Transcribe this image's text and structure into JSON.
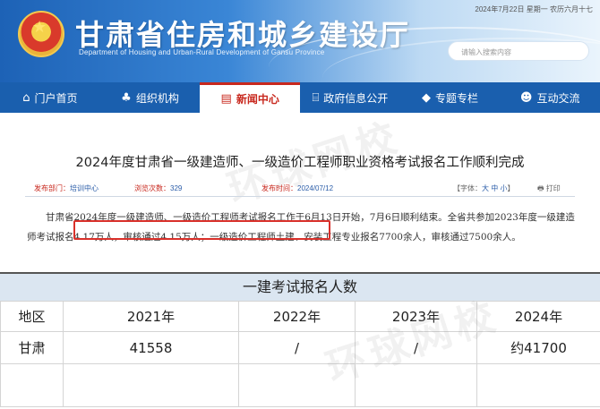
{
  "header": {
    "site_title": "甘肃省住房和城乡建设厅",
    "site_subtitle": "Department of Housing and Urban-Rural Development of Gansu Province",
    "date_line": "2024年7月22日  星期一  农历六月十七",
    "search_placeholder": "请输入搜索内容"
  },
  "nav": {
    "items": [
      {
        "label": "门户首页",
        "icon": "home-icon",
        "glyph": "⌂"
      },
      {
        "label": "组织机构",
        "icon": "org-chart-icon",
        "glyph": "♣"
      },
      {
        "label": "新闻中心",
        "icon": "news-icon",
        "glyph": "▤"
      },
      {
        "label": "政府信息公开",
        "icon": "government-building-icon",
        "glyph": "⌸"
      },
      {
        "label": "专题专栏",
        "icon": "tag-icon",
        "glyph": "◆"
      },
      {
        "label": "互动交流",
        "icon": "user-chat-icon",
        "glyph": "☻"
      }
    ],
    "active_index": 2
  },
  "article": {
    "title": "2024年度甘肃省一级建造师、一级造价工程师职业资格考试报名工作顺利完成",
    "meta": {
      "dept_label": "发布部门：",
      "dept_value": "培训中心",
      "views_label": "浏览次数：",
      "views_value": "329",
      "time_label": "发布时间：",
      "time_value": "2024/07/12",
      "font_label": "【字体：",
      "font_large": "大",
      "font_medium": "中",
      "font_small": "小",
      "font_close": "】",
      "print_label": "打印"
    },
    "body_part1": "甘肃省2024年度一级建造师、一级造价工程师考试报名工作于6月13日开始，7月6日顺利结束。全省共参加2023年度",
    "body_highlight": "一级建造师考试报名4.17万人，审核通过4.15万人；",
    "body_part2": "一级造价工程师土建、安装工程专业报名7700余人，审核通过7500余人。"
  },
  "watermark": "环球网校",
  "table": {
    "caption": "一建考试报名人数",
    "headers": [
      "地区",
      "2021年",
      "2022年",
      "2023年",
      "2024年"
    ],
    "rows": [
      [
        "甘肃",
        "41558",
        "/",
        "/",
        "约41700"
      ]
    ]
  },
  "colors": {
    "nav_bg": "#1a5fae",
    "accent_red": "#c8281e",
    "caption_bg": "#dbe6f1"
  }
}
